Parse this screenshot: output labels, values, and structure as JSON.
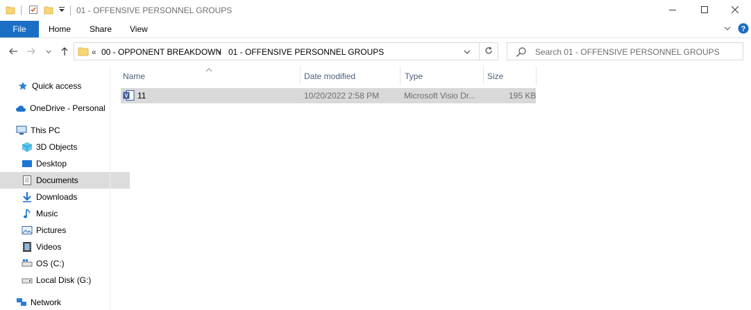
{
  "window": {
    "title": "01 - OFFENSIVE PERSONNEL GROUPS",
    "minimize_icon": "minimize-icon",
    "maximize_icon": "maximize-icon",
    "close_icon": "close-icon"
  },
  "ribbon": {
    "tabs": [
      {
        "label": "File",
        "active": true
      },
      {
        "label": "Home"
      },
      {
        "label": "Share"
      },
      {
        "label": "View"
      }
    ]
  },
  "address": {
    "overflow": "«",
    "crumbs": [
      "00 - OPPONENT BREAKDOWN",
      "01 - OFFENSIVE PERSONNEL GROUPS"
    ],
    "separator": "›"
  },
  "search": {
    "placeholder": "Search 01 - OFFENSIVE PERSONNEL GROUPS"
  },
  "sidebar": {
    "items": [
      {
        "label": "Quick access",
        "icon": "star-icon"
      },
      {
        "label": "OneDrive - Personal",
        "icon": "cloud-icon"
      },
      {
        "label": "This PC",
        "icon": "computer-icon"
      },
      {
        "label": "3D Objects",
        "icon": "cube-icon"
      },
      {
        "label": "Desktop",
        "icon": "desktop-icon"
      },
      {
        "label": "Documents",
        "icon": "document-icon",
        "selected": true
      },
      {
        "label": "Downloads",
        "icon": "download-icon"
      },
      {
        "label": "Music",
        "icon": "music-icon"
      },
      {
        "label": "Pictures",
        "icon": "picture-icon"
      },
      {
        "label": "Videos",
        "icon": "video-icon"
      },
      {
        "label": "OS (C:)",
        "icon": "drive-icon"
      },
      {
        "label": "Local Disk (G:)",
        "icon": "disk-icon"
      },
      {
        "label": "Network",
        "icon": "network-icon"
      }
    ]
  },
  "columns": {
    "name": "Name",
    "date": "Date modified",
    "type": "Type",
    "size": "Size"
  },
  "files": [
    {
      "name": "11",
      "date": "10/20/2022 2:58 PM",
      "type": "Microsoft Visio Dr...",
      "size": "195 KB",
      "icon": "visio-file-icon"
    }
  ],
  "colors": {
    "accent": "#1a6fc4",
    "selection": "#d9d9d9",
    "header_text": "#4c607a"
  }
}
